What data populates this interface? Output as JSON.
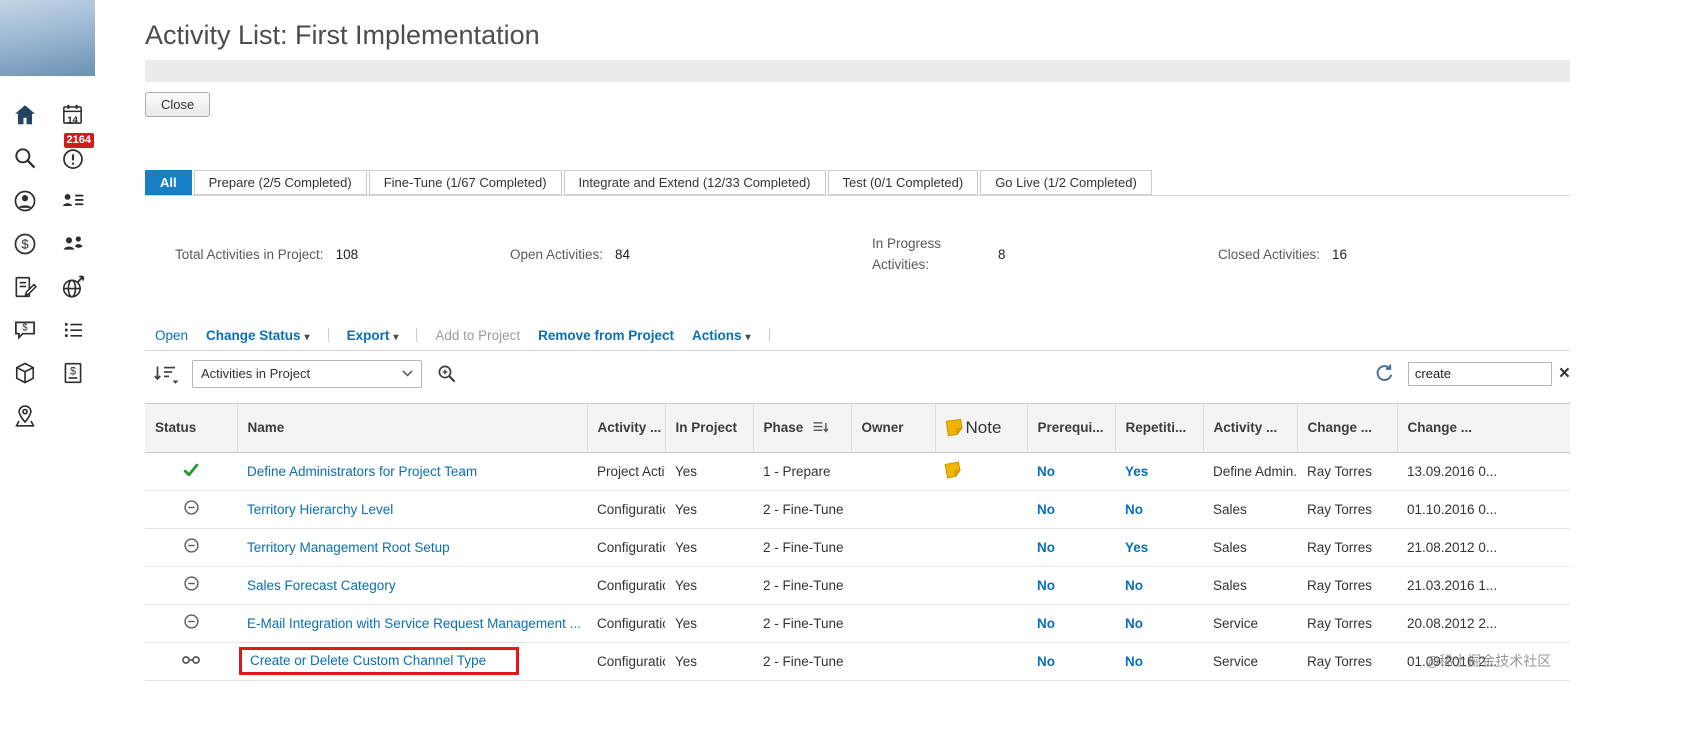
{
  "colors": {
    "accent_blue": "#1780c4",
    "link_blue": "#0a6fb3",
    "badge_red": "#cf1d1d",
    "note_yellow": "#f3b400",
    "highlight_red": "#e21717",
    "check_green": "#1f9b2d",
    "header_gray": "#f4f4f4"
  },
  "sidebar": {
    "alert_badge": "2164",
    "calendar_day": "14",
    "icons": [
      "home",
      "calendar",
      "search",
      "alerts",
      "account",
      "contacts",
      "sales",
      "org",
      "documents",
      "deploy",
      "quotes",
      "worklist",
      "products",
      "invoices",
      "visits"
    ]
  },
  "page": {
    "title": "Activity List: First Implementation",
    "close_label": "Close"
  },
  "tabs": [
    {
      "label": "All",
      "selected": true
    },
    {
      "label": "Prepare (2/5 Completed)",
      "selected": false
    },
    {
      "label": "Fine-Tune (1/67 Completed)",
      "selected": false
    },
    {
      "label": "Integrate and Extend (12/33 Completed)",
      "selected": false
    },
    {
      "label": "Test (0/1 Completed)",
      "selected": false
    },
    {
      "label": "Go Live (1/2 Completed)",
      "selected": false
    }
  ],
  "summary": {
    "items": [
      {
        "label": "Total Activities in Project:",
        "value": "108"
      },
      {
        "label": "Open Activities:",
        "value": "84"
      },
      {
        "label": "In Progress Activities:",
        "value": "8"
      },
      {
        "label": "Closed Activities:",
        "value": "16"
      }
    ]
  },
  "toolbar": {
    "items": [
      {
        "label": "Open",
        "state": "enabled",
        "has_menu": false
      },
      {
        "label": "Change Status",
        "state": "enabled",
        "has_menu": true
      },
      {
        "label": "Export",
        "state": "enabled",
        "has_menu": true
      },
      {
        "label": "Add to Project",
        "state": "disabled",
        "has_menu": false
      },
      {
        "label": "Remove from Project",
        "state": "enabled",
        "has_menu": false
      },
      {
        "label": "Actions",
        "state": "enabled",
        "has_menu": true
      }
    ]
  },
  "filter": {
    "scope_value": "Activities in Project",
    "search_value": "create"
  },
  "table": {
    "columns": [
      "Status",
      "Name",
      "Activity ...",
      "In Project",
      "Phase",
      "Owner",
      "Note",
      "Prerequi...",
      "Repetiti...",
      "Activity ...",
      "Change ...",
      "Change ..."
    ],
    "rows": [
      {
        "status": "completed",
        "name": "Define Administrators for Project Team",
        "type": "Project Activity",
        "in_project": "Yes",
        "phase": "1 - Prepare",
        "owner": "",
        "has_note": true,
        "prerequisite": "No",
        "repetition": "Yes",
        "area": "Define Admin...",
        "changed_by": "Ray Torres",
        "changed_on": "13.09.2016 0...",
        "highlighted": false
      },
      {
        "status": "open",
        "name": "Territory Hierarchy Level",
        "type": "Configuration",
        "in_project": "Yes",
        "phase": "2 - Fine-Tune",
        "owner": "",
        "has_note": false,
        "prerequisite": "No",
        "repetition": "No",
        "area": "Sales",
        "changed_by": "Ray Torres",
        "changed_on": "01.10.2016 0...",
        "highlighted": false
      },
      {
        "status": "open",
        "name": "Territory Management Root Setup",
        "type": "Configuration",
        "in_project": "Yes",
        "phase": "2 - Fine-Tune",
        "owner": "",
        "has_note": false,
        "prerequisite": "No",
        "repetition": "Yes",
        "area": "Sales",
        "changed_by": "Ray Torres",
        "changed_on": "21.08.2012 0...",
        "highlighted": false
      },
      {
        "status": "open",
        "name": "Sales Forecast Category",
        "type": "Configuration",
        "in_project": "Yes",
        "phase": "2 - Fine-Tune",
        "owner": "",
        "has_note": false,
        "prerequisite": "No",
        "repetition": "No",
        "area": "Sales",
        "changed_by": "Ray Torres",
        "changed_on": "21.03.2016 1...",
        "highlighted": false
      },
      {
        "status": "open",
        "name": "E-Mail Integration with Service Request Management ...",
        "type": "Configuration",
        "in_project": "Yes",
        "phase": "2 - Fine-Tune",
        "owner": "",
        "has_note": false,
        "prerequisite": "No",
        "repetition": "No",
        "area": "Service",
        "changed_by": "Ray Torres",
        "changed_on": "20.08.2012 2...",
        "highlighted": false
      },
      {
        "status": "linked",
        "name": "Create or Delete Custom Channel Type",
        "type": "Configuration",
        "in_project": "Yes",
        "phase": "2 - Fine-Tune",
        "owner": "",
        "has_note": false,
        "prerequisite": "No",
        "repetition": "No",
        "area": "Service",
        "changed_by": "Ray Torres",
        "changed_on": "01.09.2016 2...",
        "highlighted": true
      }
    ]
  },
  "watermark": "@稀土掘金技术社区"
}
